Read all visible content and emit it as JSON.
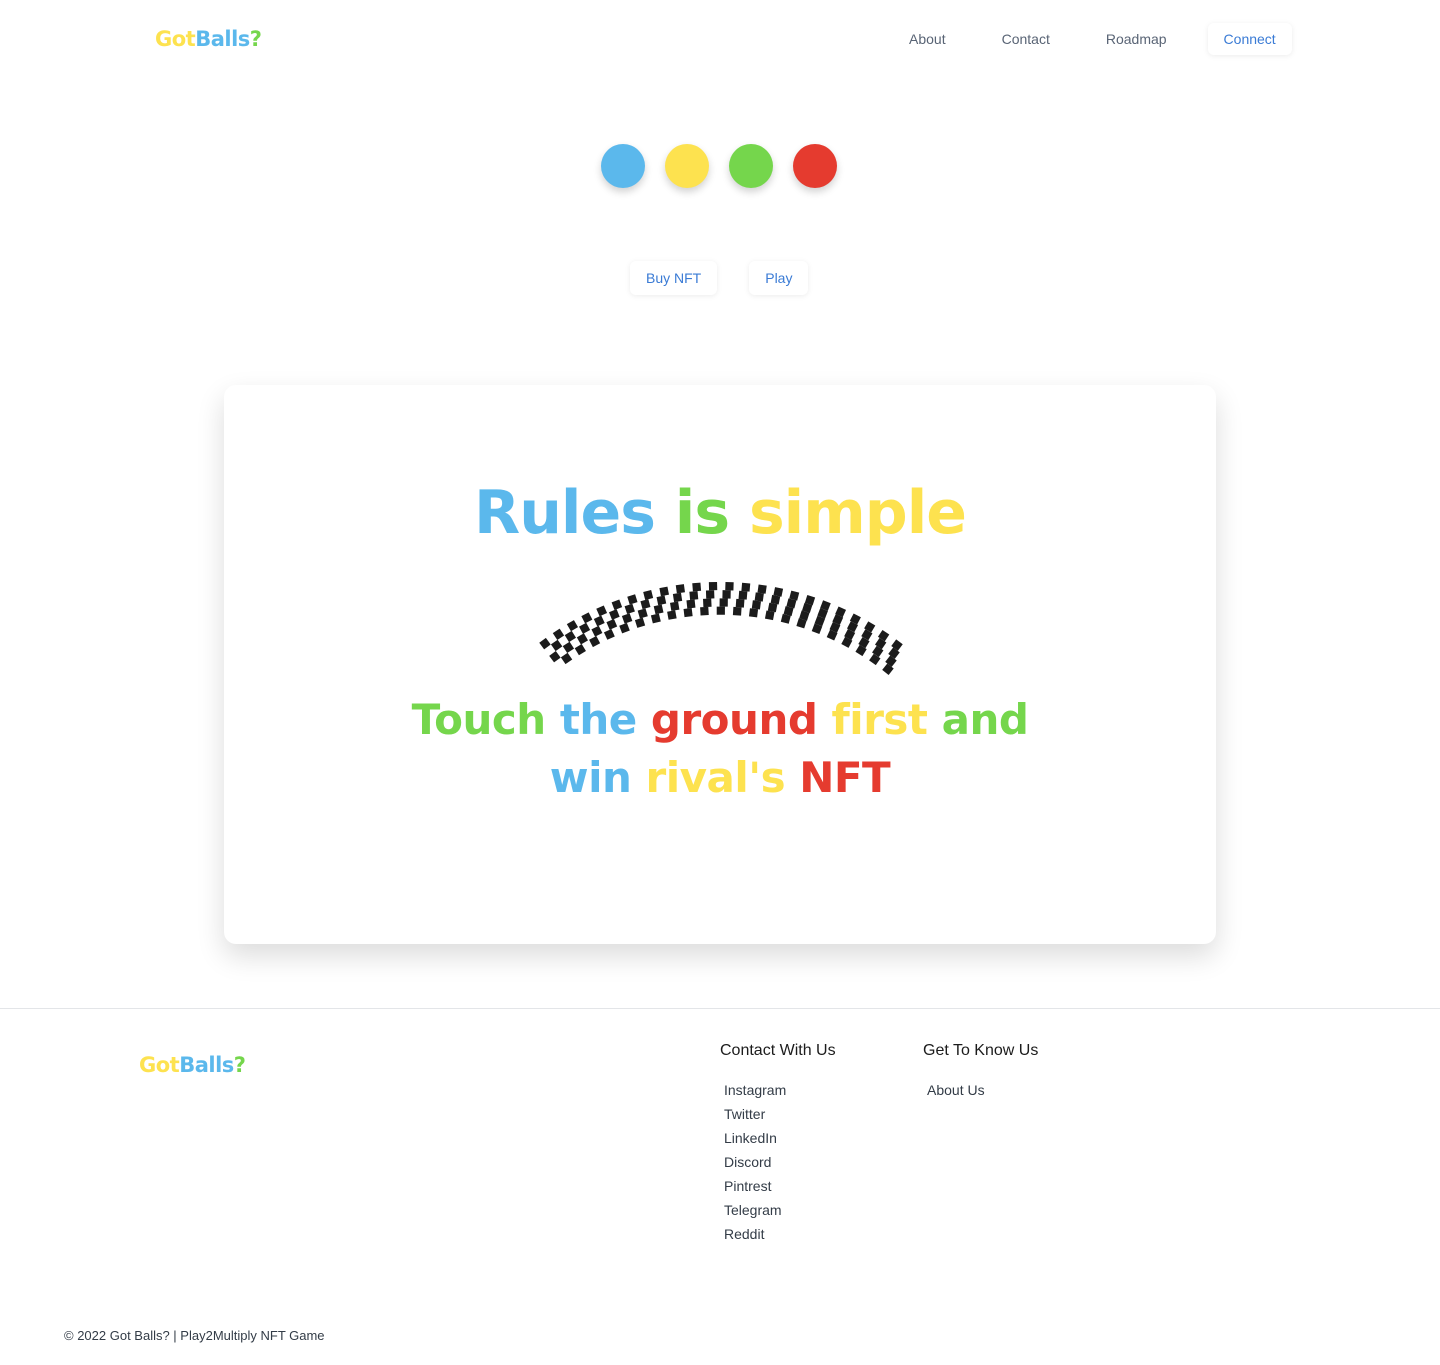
{
  "colors": {
    "blue": "#5bb8ec",
    "yellow": "#fde24f",
    "green": "#75d64c",
    "red": "#e53b2f",
    "link_blue": "#3a7bd5"
  },
  "logo": {
    "got": "Got",
    "balls": "Balls",
    "question": "?"
  },
  "nav": {
    "about": "About",
    "contact": "Contact",
    "roadmap": "Roadmap",
    "connect": "Connect"
  },
  "balls": [
    {
      "color": "#5bb8ec"
    },
    {
      "color": "#fde24f"
    },
    {
      "color": "#75d64c"
    },
    {
      "color": "#e53b2f"
    }
  ],
  "actions": {
    "buy_nft": "Buy NFT",
    "play": "Play"
  },
  "card": {
    "title": [
      {
        "text": "Rules",
        "color": "#5bb8ec"
      },
      {
        "text": "is",
        "color": "#75d64c"
      },
      {
        "text": "simple",
        "color": "#fde24f"
      }
    ],
    "subtitle_line1": [
      {
        "text": "Touch",
        "color": "#75d64c"
      },
      {
        "text": "the",
        "color": "#5bb8ec"
      },
      {
        "text": "ground",
        "color": "#e53b2f"
      },
      {
        "text": "first",
        "color": "#fde24f"
      },
      {
        "text": "and",
        "color": "#75d64c"
      }
    ],
    "subtitle_line2": [
      {
        "text": "win",
        "color": "#5bb8ec"
      },
      {
        "text": "rival's",
        "color": "#fde24f"
      },
      {
        "text": "NFT",
        "color": "#e53b2f"
      }
    ],
    "flag_icon": "checkered-flag-icon"
  },
  "footer": {
    "contact": {
      "heading": "Contact With Us",
      "links": [
        "Instagram",
        "Twitter",
        "LinkedIn",
        "Discord",
        "Pintrest",
        "Telegram",
        "Reddit"
      ]
    },
    "know": {
      "heading": "Get To Know Us",
      "links": [
        "About Us"
      ]
    },
    "copyright": "© 2022 Got Balls? | Play2Multiply NFT Game"
  }
}
